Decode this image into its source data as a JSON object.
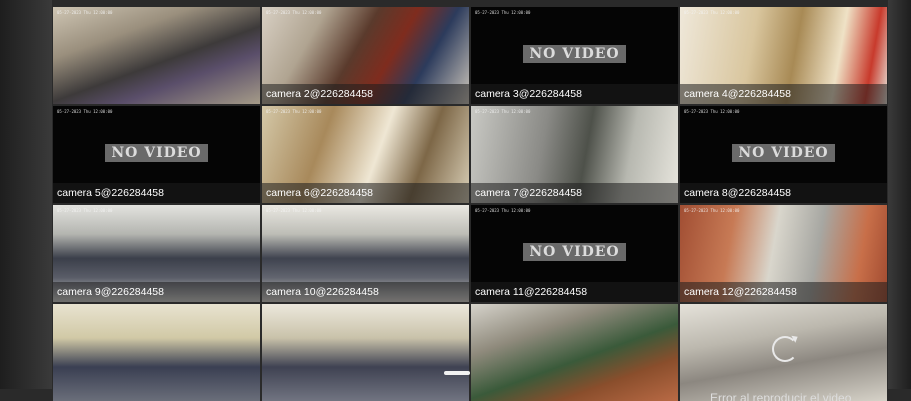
{
  "no_video_text": "NO VIDEO",
  "tiles": [
    {
      "label": "",
      "osd": "05-27-2023 Thu 12:00:00",
      "no_video": false,
      "selected": true,
      "theme": "parking"
    },
    {
      "label": "camera 2@226284458",
      "osd": "05-27-2023 Thu 12:00:00",
      "no_video": false,
      "theme": "library"
    },
    {
      "label": "camera 3@226284458",
      "osd": "05-27-2023 Thu 12:00:00",
      "no_video": true
    },
    {
      "label": "camera 4@226284458",
      "osd": "05-27-2023 Thu 12:00:00",
      "no_video": false,
      "theme": "stairs"
    },
    {
      "label": "camera 5@226284458",
      "osd": "05-27-2023 Thu 12:00:00",
      "no_video": true
    },
    {
      "label": "camera 6@226284458",
      "osd": "05-27-2023 Thu 12:00:00",
      "no_video": false,
      "theme": "hall"
    },
    {
      "label": "camera 7@226284458",
      "osd": "05-27-2023 Thu 12:00:00",
      "no_video": false,
      "theme": "corridor"
    },
    {
      "label": "camera 8@226284458",
      "osd": "05-27-2023 Thu 12:00:00",
      "no_video": true
    },
    {
      "label": "camera 9@226284458",
      "osd": "05-27-2023 Thu 12:00:00",
      "no_video": false,
      "theme": "classroom"
    },
    {
      "label": "camera 10@226284458",
      "osd": "05-27-2023 Thu 12:00:00",
      "no_video": false,
      "theme": "classroom2"
    },
    {
      "label": "camera 11@226284458",
      "osd": "05-27-2023 Thu 12:00:00",
      "no_video": true
    },
    {
      "label": "camera 12@226284458",
      "osd": "05-27-2023 Thu 12:00:00",
      "no_video": false,
      "theme": "elevator"
    },
    {
      "label": "",
      "osd": "",
      "no_video": false,
      "theme": "lab"
    },
    {
      "label": "",
      "osd": "",
      "no_video": false,
      "theme": "lab2"
    },
    {
      "label": "",
      "osd": "",
      "no_video": false,
      "theme": "courtyard"
    },
    {
      "label": "",
      "osd": "",
      "no_video": false,
      "theme": "office",
      "error": "Error al reproducir el video"
    }
  ],
  "colors": {
    "selected_border": "#c0282d",
    "label_bar": "#1e1e1e",
    "no_video_bg": "#000000"
  }
}
